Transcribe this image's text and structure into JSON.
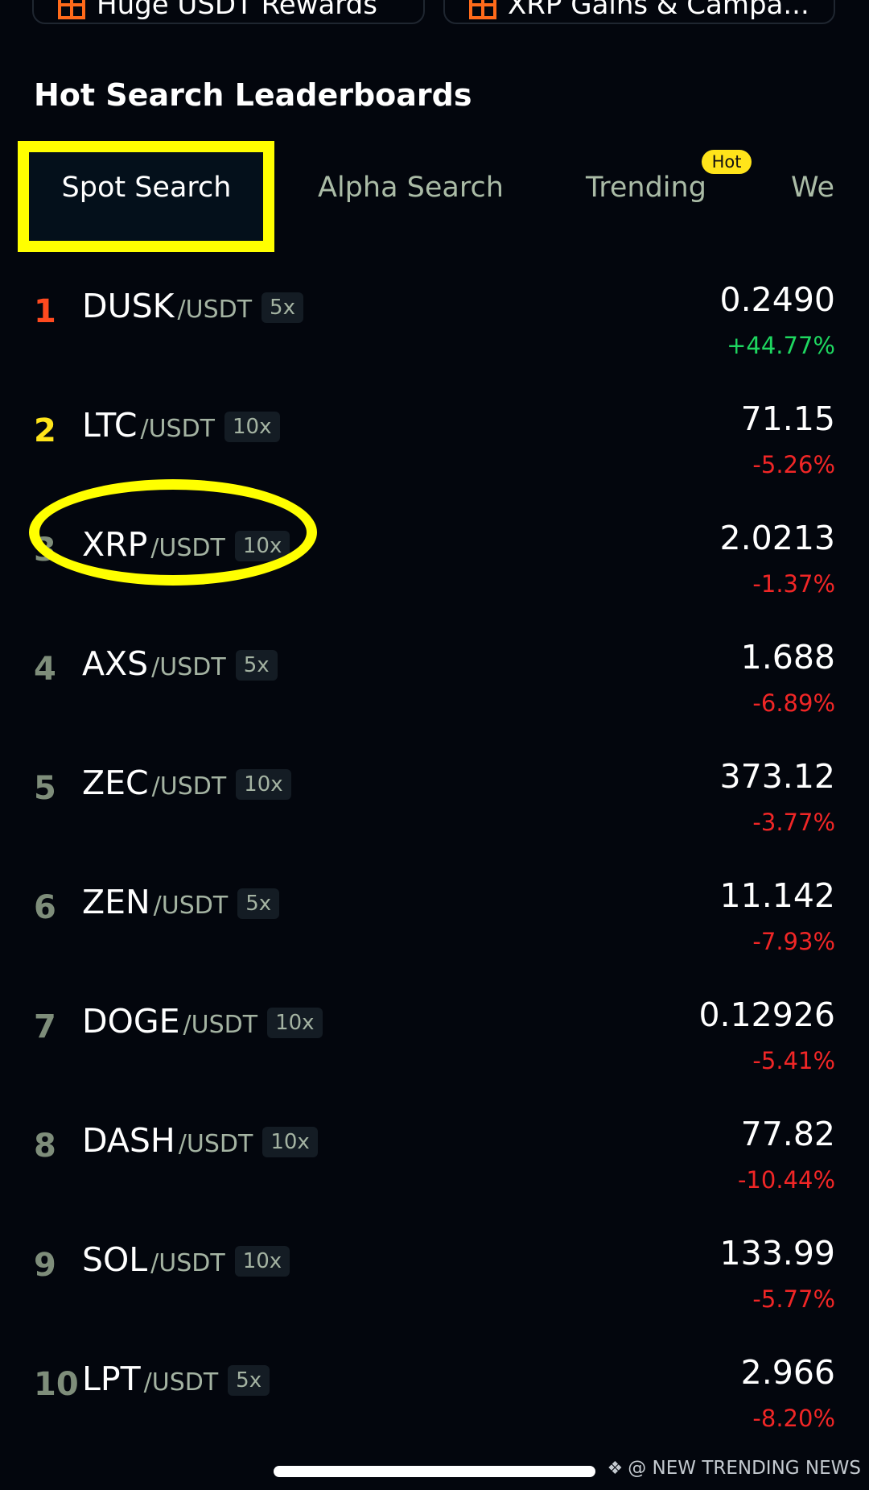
{
  "promos": [
    {
      "label": "Huge USDT Rewards",
      "icon": "gift-icon"
    },
    {
      "label": "XRP Gains & Campa...",
      "icon": "gift-icon"
    }
  ],
  "section_title": "Hot Search Leaderboards",
  "tabs": [
    {
      "label": "Spot Search",
      "active": true
    },
    {
      "label": "Alpha Search",
      "active": false
    },
    {
      "label": "Trending",
      "active": false,
      "badge": "Hot"
    },
    {
      "label": "We",
      "active": false
    }
  ],
  "rows": [
    {
      "rank": "1",
      "symbol": "DUSK",
      "quote": "/USDT",
      "leverage": "5x",
      "price": "0.2490",
      "change": "+44.77%"
    },
    {
      "rank": "2",
      "symbol": "LTC",
      "quote": "/USDT",
      "leverage": "10x",
      "price": "71.15",
      "change": "-5.26%"
    },
    {
      "rank": "3",
      "symbol": "XRP",
      "quote": "/USDT",
      "leverage": "10x",
      "price": "2.0213",
      "change": "-1.37%"
    },
    {
      "rank": "4",
      "symbol": "AXS",
      "quote": "/USDT",
      "leverage": "5x",
      "price": "1.688",
      "change": "-6.89%"
    },
    {
      "rank": "5",
      "symbol": "ZEC",
      "quote": "/USDT",
      "leverage": "10x",
      "price": "373.12",
      "change": "-3.77%"
    },
    {
      "rank": "6",
      "symbol": "ZEN",
      "quote": "/USDT",
      "leverage": "5x",
      "price": "11.142",
      "change": "-7.93%"
    },
    {
      "rank": "7",
      "symbol": "DOGE",
      "quote": "/USDT",
      "leverage": "10x",
      "price": "0.12926",
      "change": "-5.41%"
    },
    {
      "rank": "8",
      "symbol": "DASH",
      "quote": "/USDT",
      "leverage": "10x",
      "price": "77.82",
      "change": "-10.44%"
    },
    {
      "rank": "9",
      "symbol": "SOL",
      "quote": "/USDT",
      "leverage": "10x",
      "price": "133.99",
      "change": "-5.77%"
    },
    {
      "rank": "10",
      "symbol": "LPT",
      "quote": "/USDT",
      "leverage": "5x",
      "price": "2.966",
      "change": "-8.20%"
    }
  ],
  "watermark": "@ NEW TRENDING NEWS",
  "colors": {
    "rank_1": "#ff4a1f",
    "rank_2": "#ffe41a",
    "rank_default": "#7e8d7a",
    "positive": "#1ed760",
    "negative": "#f02626",
    "highlight": "#ffff00"
  }
}
